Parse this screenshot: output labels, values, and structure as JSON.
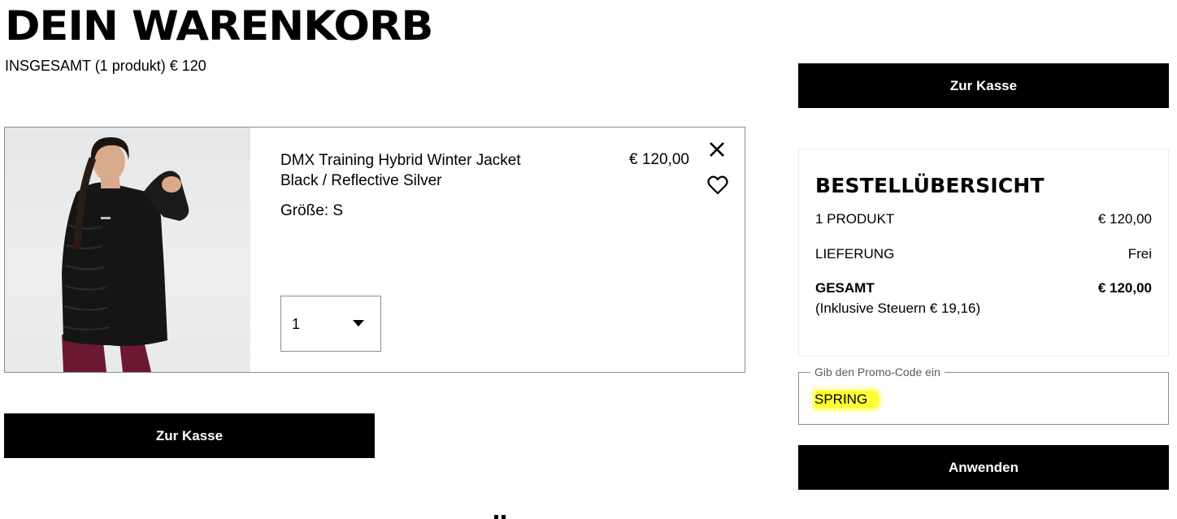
{
  "page": {
    "title": "DEIN WARENKORB",
    "total_summary": "INSGESAMT (1 produkt) € 120"
  },
  "cart_item": {
    "name": "DMX Training Hybrid Winter Jacket",
    "color": "Black / Reflective Silver",
    "size": "Größe: S",
    "price": "€ 120,00",
    "quantity": "1",
    "image": "woman-in-black-jacket-photo",
    "remove_icon": "close-icon",
    "wishlist_icon": "heart-icon"
  },
  "buttons": {
    "checkout_label": "Zur Kasse",
    "apply_label": "Anwenden"
  },
  "order_summary": {
    "title": "BESTELLÜBERSICHT",
    "products_label": "1 PRODUKT",
    "products_value": "€ 120,00",
    "delivery_label": "LIEFERUNG",
    "delivery_value": "Frei",
    "total_label": "GESAMT",
    "total_value": "€ 120,00",
    "tax_note": "(Inklusive Steuern  € 19,16)"
  },
  "promo": {
    "label": "Gib den Promo-Code ein",
    "value": "SPRING",
    "highlight_color": "#ffff33"
  },
  "colors": {
    "button_bg": "#000000",
    "button_text": "#ffffff",
    "border": "#8c8c8c"
  }
}
